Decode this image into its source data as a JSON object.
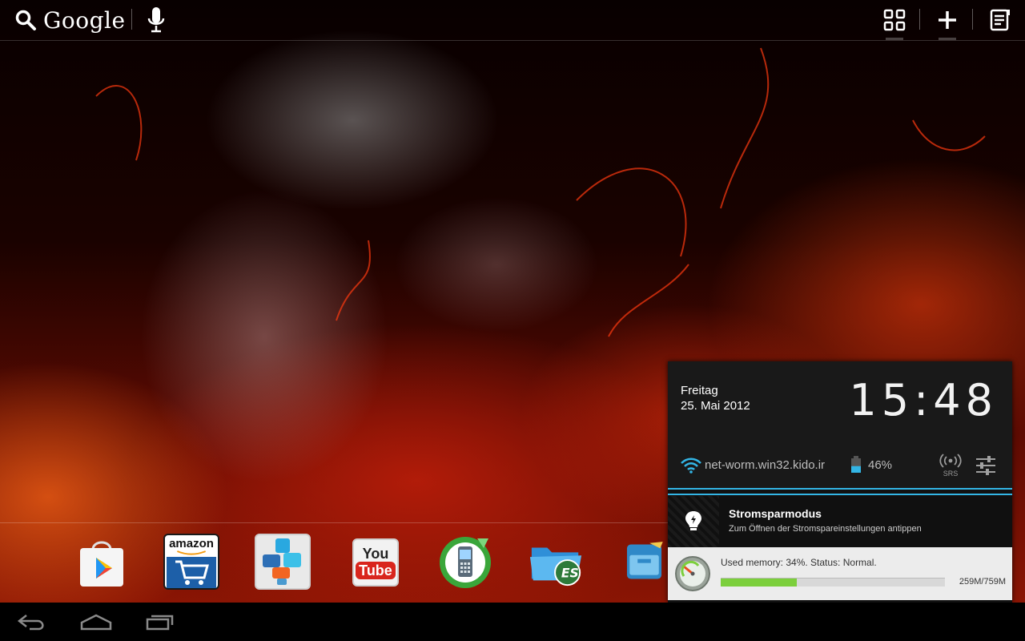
{
  "topbar": {
    "search_label": "Google"
  },
  "dock": {
    "amazon_label": "amazon",
    "youtube_you": "You",
    "youtube_tube": "Tube"
  },
  "notification_panel": {
    "day": "Freitag",
    "date": "25. Mai 2012",
    "clock": "15:48",
    "network": "net-worm.win32.kido.ir",
    "battery": "46%",
    "battery_level": 0.46,
    "srs_label": "SRS",
    "power_saving": {
      "title": "Stromsparmodus",
      "subtitle": "Zum Öffnen der Stromspareinstellungen antippen"
    },
    "memory": {
      "status": "Used memory: 34%. Status: Normal.",
      "used_fraction": 0.34,
      "size": "259M/759M"
    }
  },
  "colors": {
    "accent": "#33b5e5",
    "memory_bar": "#7ccf3c"
  }
}
